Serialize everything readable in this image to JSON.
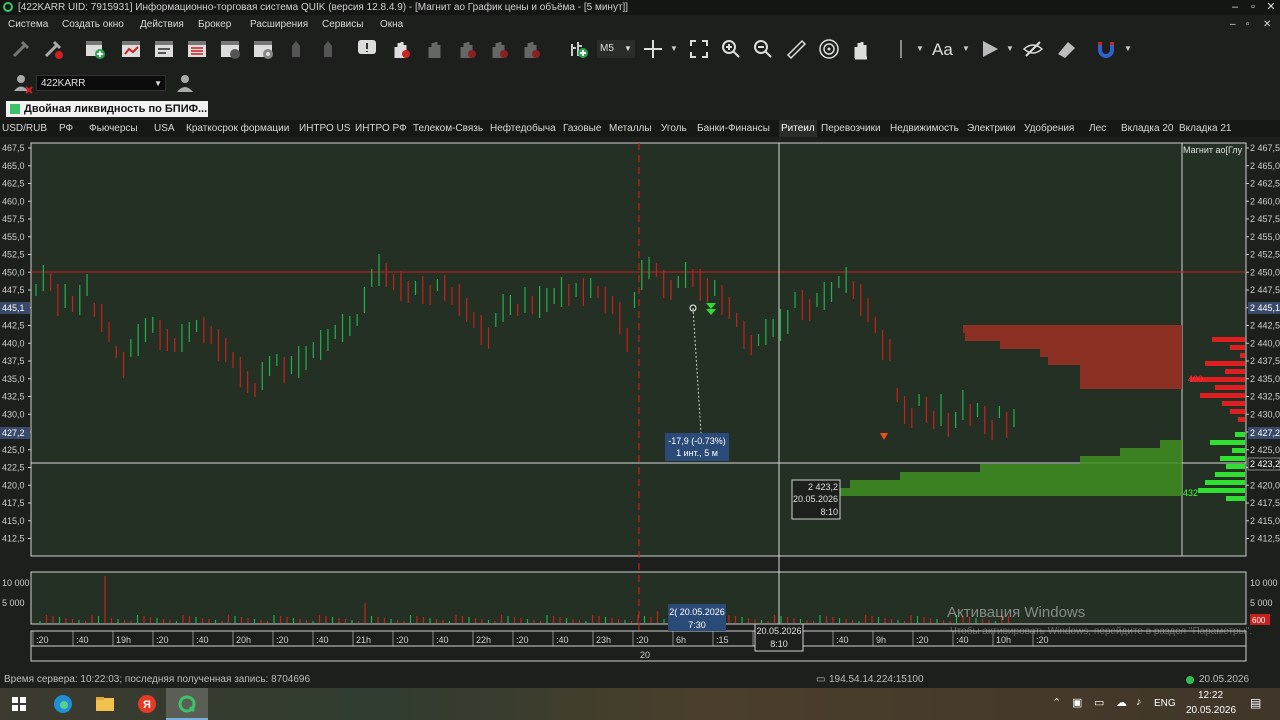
{
  "window": {
    "title": "[422KARR UID: 7915931] Информационно-торговая система QUIK (версия 12.8.4.9) - [Магнит ао График цены и объёма - [5 минут]]",
    "controls": [
      "–",
      "▫",
      "✕"
    ],
    "inner_controls": [
      "–",
      "▫",
      "✕"
    ]
  },
  "menu": [
    "Система",
    "Создать окно",
    "Действия",
    "Брокер",
    "Расширения",
    "Сервисы",
    "Окна"
  ],
  "toolbar": {
    "interval": "M5",
    "font_label": "Aa"
  },
  "account": {
    "value": "422KARR"
  },
  "ad_banner": "Двойная ликвидность по  БПИФ...",
  "tabs": [
    "USD/RUB",
    "РФ",
    "Фьючерсы",
    "USA",
    "Краткосрок формации",
    "ИНТРО US",
    "ИНТРО РФ",
    "Телеком-Связь",
    "Нефтедобыча",
    "Газовые",
    "Металлы",
    "Уголь",
    "Банки-Финансы",
    "Ритеил",
    "Перевозчики",
    "Недвижимость",
    "Электрики",
    "Удобрения",
    "Лес",
    "Вкладка 20",
    "Вкладка 21"
  ],
  "active_tab": "Ритеил",
  "chart": {
    "legend": "Магнит ао[Глу",
    "left_price_labels": [
      "467,5",
      "465,0",
      "462,5",
      "460,0",
      "457,5",
      "455,0",
      "452,5",
      "450,0",
      "447,5",
      "445,1",
      "442,5",
      "440,0",
      "437,5",
      "435,0",
      "432,5",
      "430,0",
      "427,2",
      "425,0",
      "422,5",
      "420,0",
      "417,5",
      "415,0",
      "412,5"
    ],
    "right_price_labels": [
      "2 467,5",
      "2 465,0",
      "2 462,5",
      "2 460,0",
      "2 457,5",
      "2 455,0",
      "2 452,5",
      "2 450,0",
      "2 447,5",
      "2 445,1",
      "2 442,5",
      "2 440,0",
      "2 437,5",
      "2 435,0",
      "2 432,5",
      "2 430,0",
      "2 427,2",
      "2 425,0",
      "2 423,2",
      "2 420,0",
      "2 417,5",
      "2 415,0",
      "2 412,5"
    ],
    "current_price_left": "445,1",
    "current_price_left2": "427,2",
    "current_price_right": "2 445,1",
    "current_price_right2": "2 427,2",
    "crosshair_price": "2 423,2",
    "measure": {
      "line1": "-17,9 (-0.73%)",
      "line2": "1 инт., 5 м"
    },
    "cursor_box": {
      "price": "2 423,2",
      "date": "20.05.2026",
      "time": "8:10"
    },
    "profile_labels": {
      "sell": "400",
      "buy": "432"
    },
    "volume_labels": [
      "10 000",
      "5 000"
    ],
    "volume_labels_right": [
      "10 000",
      "5 000"
    ],
    "volume_marker": "600",
    "time_labels": [
      ":20",
      ":40",
      "19h",
      ":20",
      ":40",
      "20h",
      ":20",
      ":40",
      "21h",
      ":20",
      ":40",
      "22h",
      ":20",
      ":40",
      "23h",
      ":20",
      "6h",
      ":15",
      ":35",
      "8:10",
      ":40",
      "9h",
      ":20",
      ":40",
      "10h",
      ":20"
    ],
    "time_row2": "20",
    "time_tooltip": {
      "date": "2( 20.05.2026",
      "time": "7:30"
    },
    "cursor_time": {
      "date": "20.05.2026",
      "time": "8:10"
    }
  },
  "status": {
    "server": "Время сервера: 10:22:03; последняя полученная запись: 8704696",
    "connection": "194.54.14.224:15100",
    "date": "20.05.2026"
  },
  "watermark": {
    "title": "Активация Windows",
    "text": "Чтобы активировать Windows, перейдите в раздел \"Параметры\"."
  },
  "taskbar": {
    "lang": "ENG",
    "time": "12:22",
    "date": "20.05.2026"
  },
  "colors": {
    "bull": "#22b14c",
    "bear": "#c8201c",
    "grid_bg": "#243024",
    "profile_sell": "#8b3022",
    "profile_buy": "#3f8f22"
  }
}
